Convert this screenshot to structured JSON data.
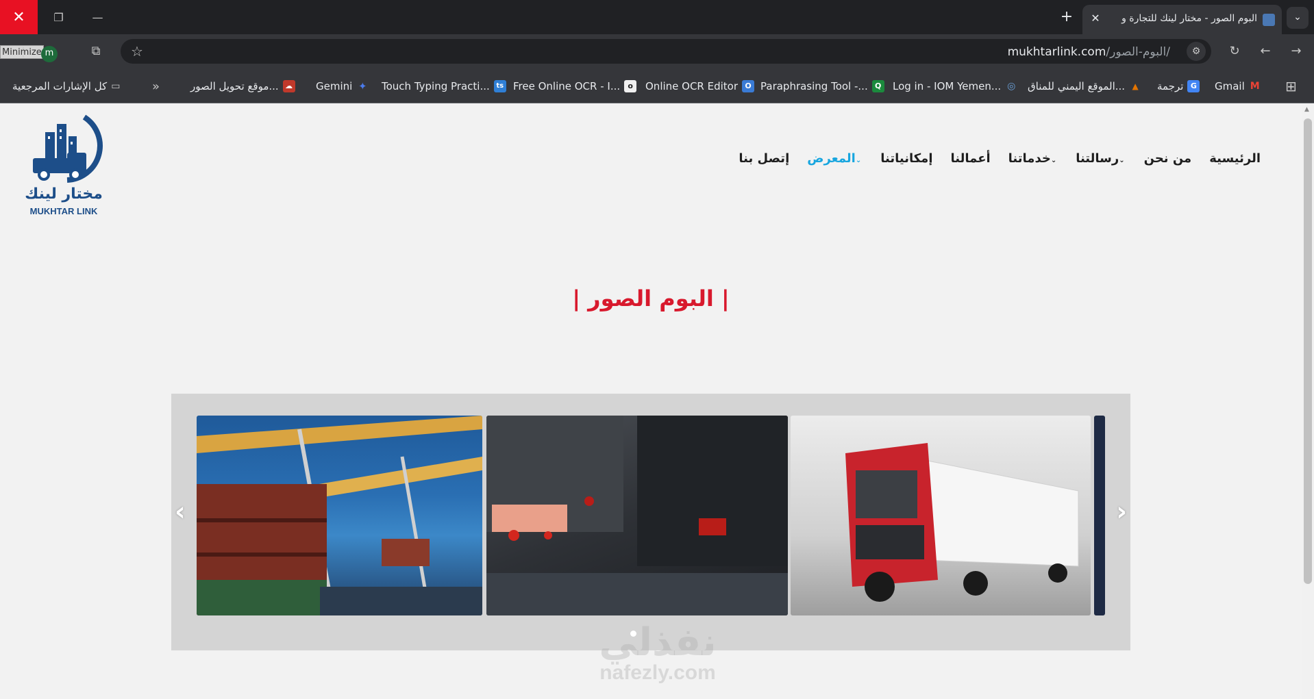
{
  "browser": {
    "tab_title": "البوم الصور - مختار لينك للتجارة و",
    "tab_close": "✕",
    "new_tab": "+",
    "tab_search": "⌄",
    "window_close": "✕",
    "window_restore": "❐",
    "window_minimize": "—",
    "tooltip": "Minimize",
    "profile_initial": "m",
    "url_host": "mukhtarlink.com",
    "url_path": "/البوم-الصور/",
    "nav_back": "←",
    "nav_forward": "→",
    "reload": "↻",
    "bookmark_star": "☆",
    "extensions": "⧉",
    "menu": "⋮",
    "tune": "⚙",
    "apps": "⊞"
  },
  "bookmarks": [
    {
      "label": "Gmail",
      "icon": "gmail-icon",
      "color": "#ea4335",
      "glyph": "M"
    },
    {
      "label": "ترجمة",
      "icon": "translate-icon",
      "color": "#4285f4",
      "glyph": "G"
    },
    {
      "label": "الموقع اليمني للمناق...",
      "icon": "yemen-site-icon",
      "color": "#e37400",
      "glyph": "▲"
    },
    {
      "label": "Log in - IOM Yemen...",
      "icon": "iom-icon",
      "color": "#1f6fb2",
      "glyph": "◎"
    },
    {
      "label": "Paraphrasing Tool -...",
      "icon": "quillbot-icon",
      "color": "#1b8a3d",
      "glyph": "Q"
    },
    {
      "label": "Online OCR Editor",
      "icon": "ocr-editor-icon",
      "color": "#3a7bd5",
      "glyph": "O"
    },
    {
      "label": "Free Online OCR - I...",
      "icon": "free-ocr-icon",
      "color": "#222222",
      "glyph": "o"
    },
    {
      "label": "Touch Typing Practi...",
      "icon": "typing-icon",
      "color": "#2f7fd6",
      "glyph": "ts"
    },
    {
      "label": "Gemini",
      "icon": "gemini-icon",
      "color": "#4b7bec",
      "glyph": "✦"
    },
    {
      "label": "موقع تحويل الصور...",
      "icon": "image-convert-icon",
      "color": "#c0392b",
      "glyph": "☁"
    }
  ],
  "bookmarks_overflow": "»",
  "all_bookmarks": "كل الإشارات المرجعية",
  "site": {
    "logo_ar": "مختار لينك",
    "logo_en": "MUKHTAR LINK",
    "nav": [
      {
        "label": "الرئيسية",
        "has_caret": false,
        "active": false
      },
      {
        "label": "من نحن",
        "has_caret": false,
        "active": false
      },
      {
        "label": "رسالتنا",
        "has_caret": true,
        "active": false
      },
      {
        "label": "خدماتنا",
        "has_caret": true,
        "active": false
      },
      {
        "label": "أعمالنا",
        "has_caret": false,
        "active": false
      },
      {
        "label": "إمكانياتنا",
        "has_caret": false,
        "active": false
      },
      {
        "label": "المعرض",
        "has_caret": true,
        "active": true
      },
      {
        "label": "إتصل بنا",
        "has_caret": false,
        "active": false
      }
    ],
    "caret": "⌄",
    "page_heading": "| البوم الصور |",
    "slider": {
      "prev": "‹",
      "next": "›",
      "slides": [
        "port-cranes-photo",
        "trucks-traffic-photo",
        "red-truck-photo",
        "partial-slide-photo"
      ],
      "dots": 1
    },
    "accent_color": "#18a6df",
    "heading_color": "#d8192d"
  },
  "watermark": {
    "ar": "نفذلي",
    "en": "nafezly.com"
  }
}
